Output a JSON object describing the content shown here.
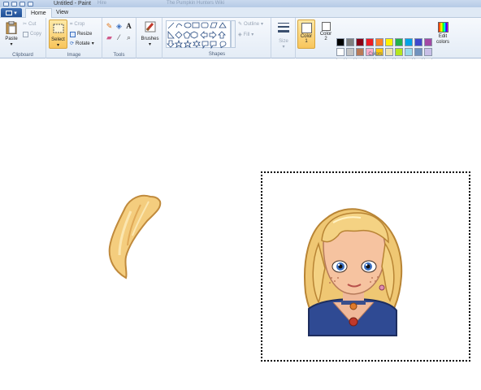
{
  "window": {
    "title": "Untitled - Paint",
    "background_items": [
      "Hire",
      "The Pumpkin Hunters Wiki"
    ]
  },
  "tabs": {
    "file_label": "▾",
    "home": "Home",
    "view": "View"
  },
  "clipboard": {
    "paste": "Paste",
    "cut": "Cut",
    "copy": "Copy",
    "label": "Clipboard"
  },
  "image": {
    "select": "Select",
    "crop": "Crop",
    "resize": "Resize",
    "rotate": "Rotate",
    "label": "Image"
  },
  "tools": {
    "text_glyph": "A",
    "label": "Tools"
  },
  "brushes": {
    "label": "Brushes"
  },
  "shapes": {
    "outline": "Outline",
    "fill": "Fill",
    "label": "Shapes"
  },
  "size": {
    "label": "Size"
  },
  "colors": {
    "color1": "Color 1",
    "color1_top": "Color",
    "color1_bottom": "1",
    "color2_top": "Color",
    "color2_bottom": "2",
    "edit_top": "Edit",
    "edit_bottom": "colors",
    "label": "Colors",
    "palette_row1": [
      "#000000",
      "#7f7f7f",
      "#880015",
      "#ed1c24",
      "#ff7f27",
      "#fff200",
      "#22b14c",
      "#00a2e8",
      "#3f48cc",
      "#a349a4"
    ],
    "palette_row2": [
      "#ffffff",
      "#c3c3c3",
      "#b97a57",
      "#ffaec9",
      "#ffc90e",
      "#efe4b0",
      "#b5e61d",
      "#99d9ea",
      "#7092be",
      "#c8bfe7"
    ]
  }
}
